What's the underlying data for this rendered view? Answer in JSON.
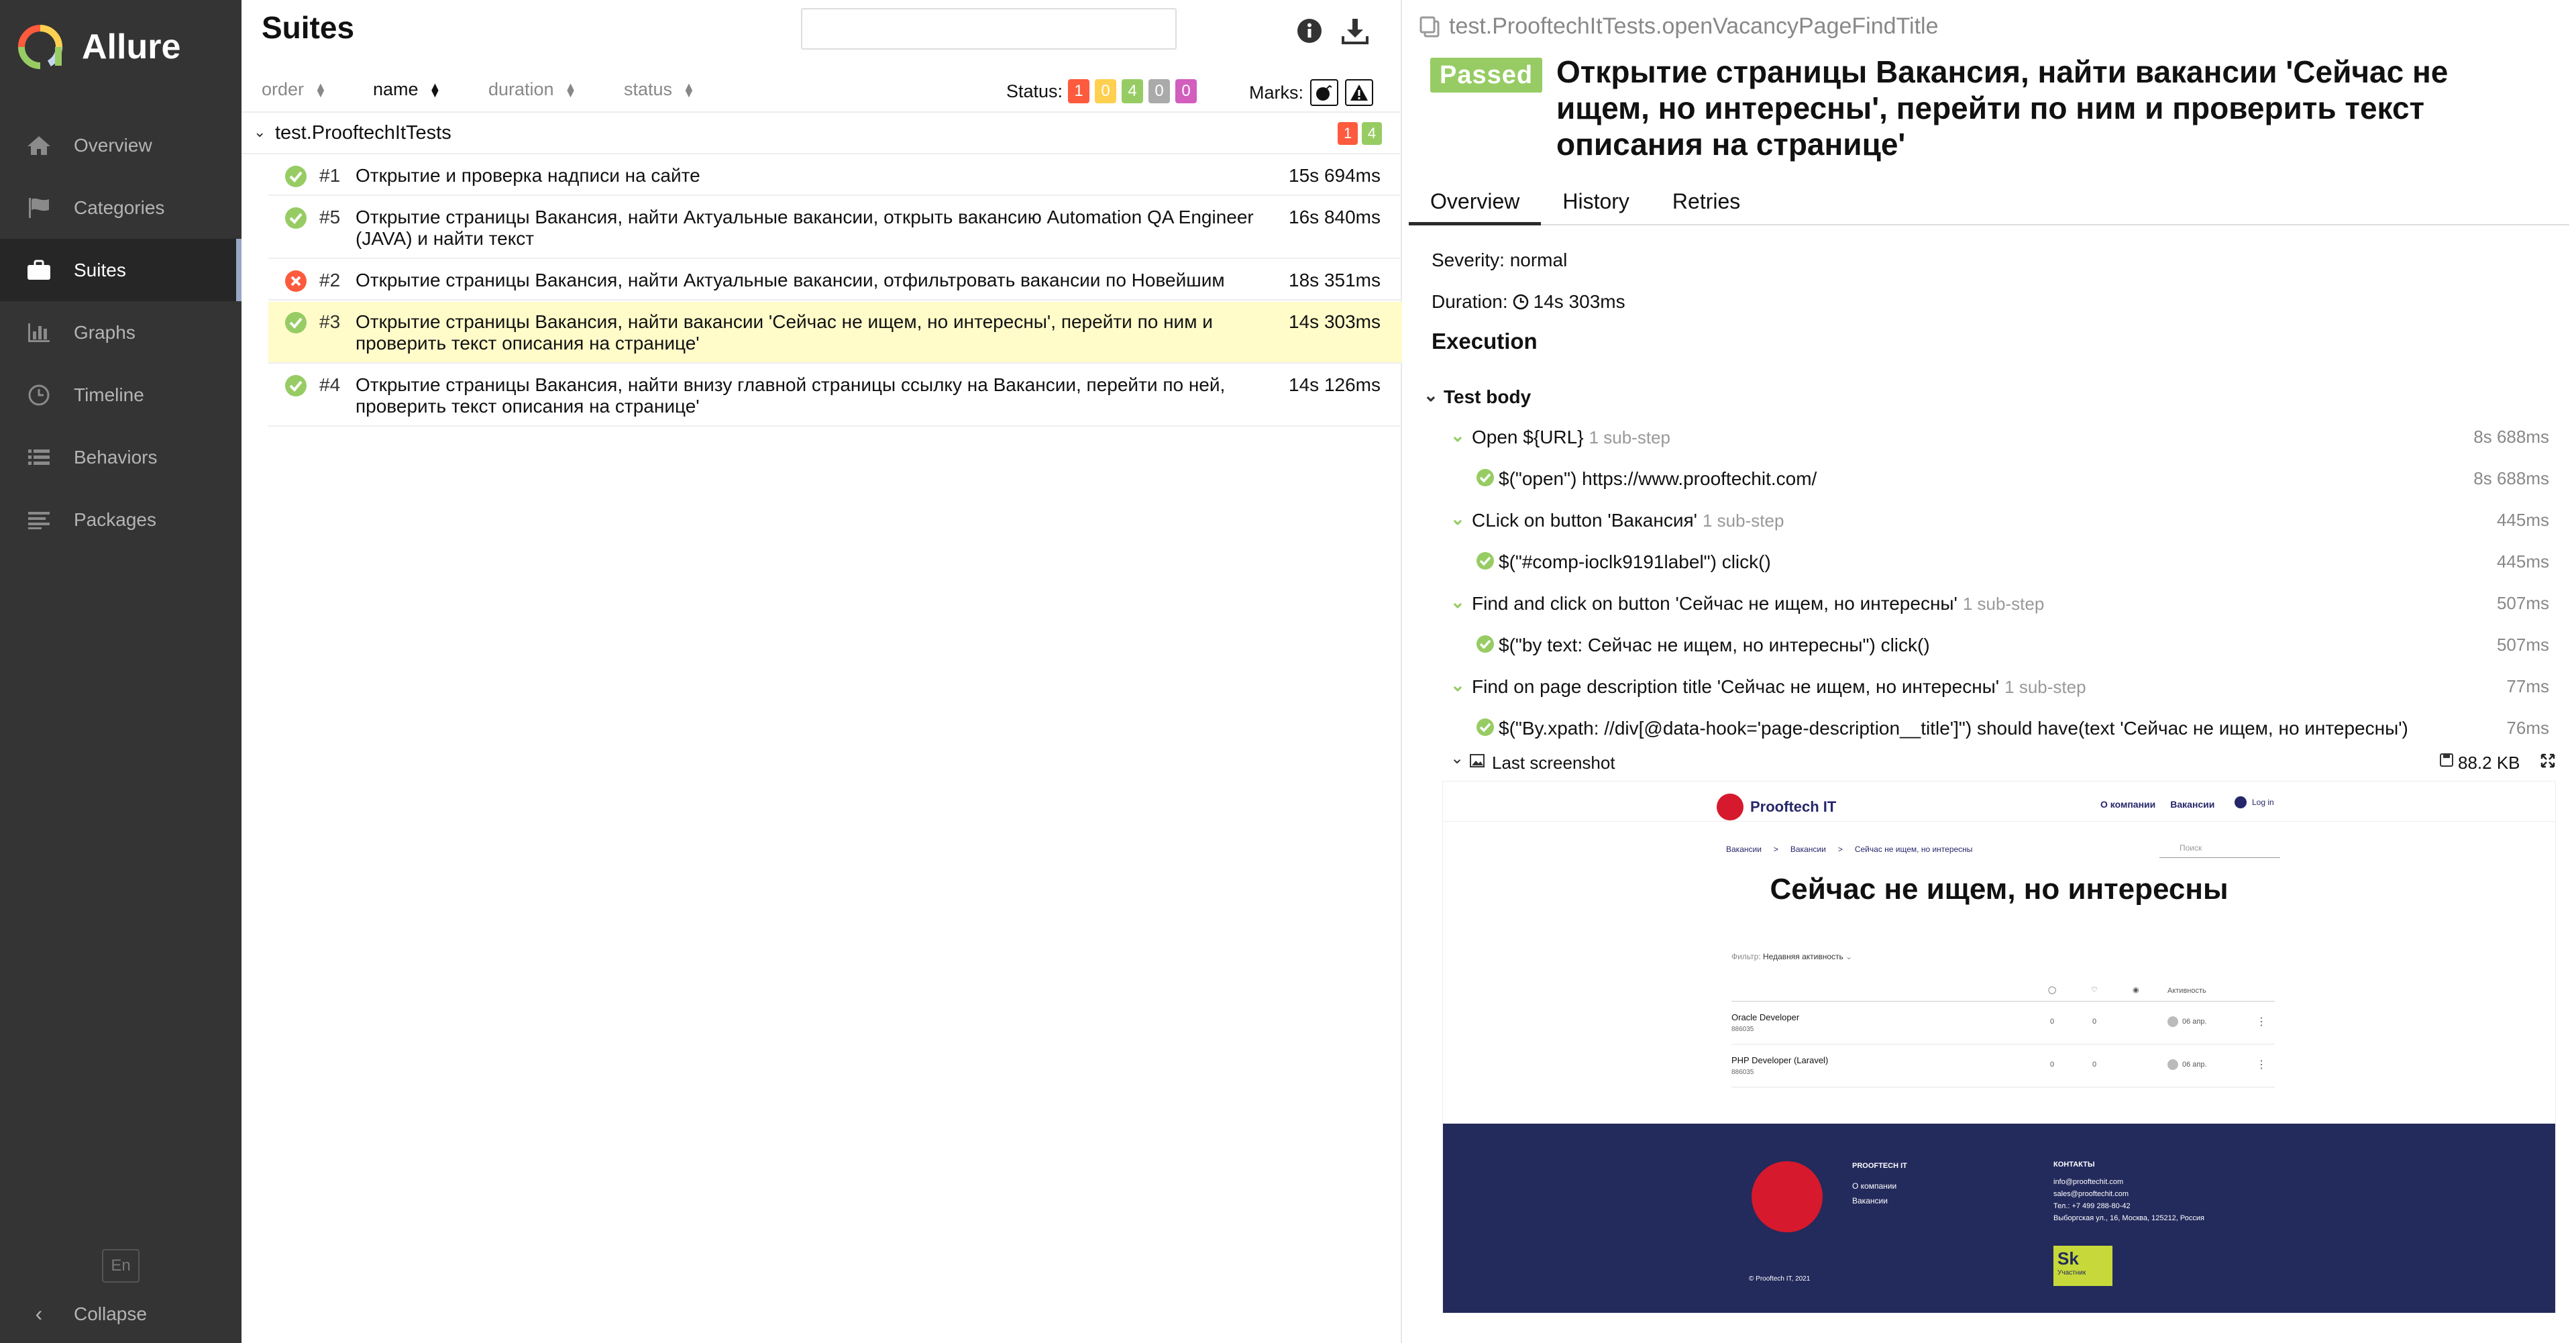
{
  "colors": {
    "sidebar_bg": "#343434",
    "passed": "#97cc64",
    "failed": "#fd5a3e",
    "broken": "#ffd050",
    "skipped": "#aaaaaa",
    "unknown": "#d35ebe",
    "selected_row": "#fffcc9"
  },
  "sidebar": {
    "brand": "Allure",
    "items": [
      {
        "label": "Overview",
        "icon": "home-icon"
      },
      {
        "label": "Categories",
        "icon": "flag-icon"
      },
      {
        "label": "Suites",
        "icon": "briefcase-icon",
        "active": true
      },
      {
        "label": "Graphs",
        "icon": "bar-chart-icon"
      },
      {
        "label": "Timeline",
        "icon": "clock-icon"
      },
      {
        "label": "Behaviors",
        "icon": "list-icon"
      },
      {
        "label": "Packages",
        "icon": "lines-icon"
      }
    ],
    "lang": "En",
    "collapse": "Collapse"
  },
  "suites": {
    "title": "Suites",
    "search_placeholder": "",
    "sort": {
      "order": "order",
      "name": "name",
      "duration": "duration",
      "status": "status"
    },
    "status_label": "Status:",
    "status_counts": {
      "failed": "1",
      "broken": "0",
      "passed": "4",
      "skipped": "0",
      "unknown": "0"
    },
    "marks_label": "Marks:",
    "group": {
      "name": "test.ProoftechItTests",
      "failed": "1",
      "passed": "4"
    },
    "tests": [
      {
        "num": "#1",
        "title": "Открытие и проверка надписи на сайте",
        "duration": "15s 694ms",
        "status": "passed"
      },
      {
        "num": "#5",
        "title": "Открытие страницы Вакансия, найти Актуальные вакансии, открыть вакансию Automation QA Engineer (JAVA) и найти текст",
        "duration": "16s 840ms",
        "status": "passed"
      },
      {
        "num": "#2",
        "title": "Открытие страницы Вакансия, найти Актуальные вакансии, отфильтровать вакансии по Новейшим",
        "duration": "18s 351ms",
        "status": "failed"
      },
      {
        "num": "#3",
        "title": "Открытие страницы Вакансия, найти вакансии 'Сейчас не ищем, но интересны', перейти по ним и проверить текст описания на странице'",
        "duration": "14s 303ms",
        "status": "passed"
      },
      {
        "num": "#4",
        "title": "Открытие страницы Вакансия, найти внизу главной страницы ссылку на Вакансии, перейти по ней, проверить текст описания на странице'",
        "duration": "14s 126ms",
        "status": "passed"
      }
    ]
  },
  "detail": {
    "path": "test.ProoftechItTests.openVacancyPageFindTitle",
    "status": "Passed",
    "title": "Открытие страницы Вакансия, найти вакансии 'Сейчас не ищем, но интересны', перейти по ним и проверить текст описания на странице'",
    "tabs": [
      "Overview",
      "History",
      "Retries"
    ],
    "severity": "Severity: normal",
    "duration_label": "Duration:",
    "duration": "14s 303ms",
    "execution": "Execution",
    "test_body": "Test body",
    "steps": [
      {
        "text": "Open ${URL}",
        "sub": "1 sub-step",
        "time": "8s 688ms",
        "level": 1
      },
      {
        "text": "$(\"open\") https://www.prooftechit.com/",
        "sub": "",
        "time": "8s 688ms",
        "level": 2
      },
      {
        "text": "CLick on button 'Вакансия'",
        "sub": "1 sub-step",
        "time": "445ms",
        "level": 1
      },
      {
        "text": "$(\"#comp-ioclk9191label\") click()",
        "sub": "",
        "time": "445ms",
        "level": 2
      },
      {
        "text": "Find and click on button 'Сейчас не ищем, но интересны'",
        "sub": "1 sub-step",
        "time": "507ms",
        "level": 1
      },
      {
        "text": "$(\"by text: Сейчас не ищем, но интересны\") click()",
        "sub": "",
        "time": "507ms",
        "level": 2
      },
      {
        "text": "Find on page description title 'Сейчас не ищем, но интересны'",
        "sub": "1 sub-step",
        "time": "77ms",
        "level": 1
      },
      {
        "text": "$(\"By.xpath: //div[@data-hook='page-description__title']\") should have(text 'Сейчас не ищем, но интересны')",
        "sub": "",
        "time": "76ms",
        "level": 2
      }
    ],
    "attachment": {
      "name": "Last screenshot",
      "size": "88.2 KB"
    }
  },
  "screenshot": {
    "logo": "Prooftech IT",
    "nav": [
      "О компании",
      "Вакансии"
    ],
    "login": "Log in",
    "crumbs": [
      "Вакансии",
      ">",
      "Вакансии",
      ">",
      "Сейчас не ищем, но интересны"
    ],
    "search": "Поиск",
    "heading": "Сейчас не ищем, но интересны",
    "filter_label": "Фильтр:",
    "filter_value": "Недавняя активность",
    "activity": "Активность",
    "rows": [
      {
        "name": "Oracle Developer",
        "id": "886035",
        "c1": "0",
        "c2": "0",
        "c3": "06 апр."
      },
      {
        "name": "PHP Developer (Laravel)",
        "id": "886035",
        "c1": "0",
        "c2": "0",
        "c3": "06 апр."
      }
    ],
    "footer": {
      "col1_head": "PROOFTECH IT",
      "col1": [
        "О компании",
        "Вакансии"
      ],
      "col2_head": "КОНТАКТЫ",
      "col2": [
        "info@prooftechit.com",
        "sales@prooftechit.com",
        "Тел.: +7 499 288-80-42",
        "Выборгская ул., 16, Москва, 125212, Россия"
      ],
      "copyright": "© Prooftech IT, 2021",
      "sk": "Sk",
      "sk_sub": "Участник"
    }
  }
}
